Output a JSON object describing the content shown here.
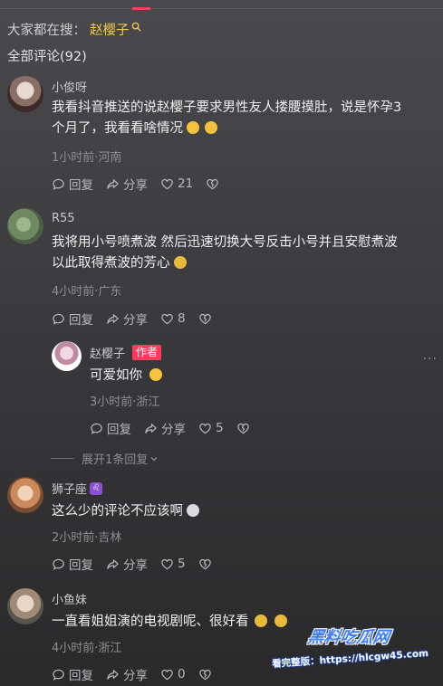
{
  "search_hint": {
    "prefix": "大家都在搜：",
    "term": "赵樱子"
  },
  "comments_total": "全部评论(92)",
  "labels": {
    "reply": "回复",
    "share": "分享",
    "author_badge": "作者"
  },
  "comments": [
    {
      "nickname": "小俊呀",
      "text_line1": "我看抖音推送的说赵樱子要求男性友人搂腰摸肚，说是怀孕3",
      "text_line2": "个月了，我看看啥情况",
      "meta": "1小时前·河南",
      "likes": "21"
    },
    {
      "nickname": "R55",
      "text_line1": "我将用小号喷煮波 然后迅速切换大号反击小号并且安慰煮波",
      "text_line2": "以此取得煮波的芳心",
      "meta": "4小时前·广东",
      "likes": "8"
    },
    {
      "nickname": "赵樱子",
      "text_line1": "可爱如你",
      "meta": "3小时前·浙江",
      "likes": "5"
    },
    {
      "nickname": "狮子座",
      "text_line1": "这么少的评论不应该啊",
      "meta": "2小时前·吉林",
      "likes": "5"
    },
    {
      "nickname": "小鱼妹",
      "text_line1": "一直看姐姐演的电视剧呢、很好看",
      "meta": "4小时前·浙江",
      "likes": "0"
    }
  ],
  "expand_replies": "展开1条回复",
  "more_icon": "ellipsis-icon",
  "watermark": {
    "logo": "黑料吃瓜网",
    "url": "看完整版：https://hlcgw45.com"
  },
  "colors": {
    "accent": "#ff3b5c",
    "search_term": "#f2c94c",
    "watermark": "#3d7bff"
  }
}
